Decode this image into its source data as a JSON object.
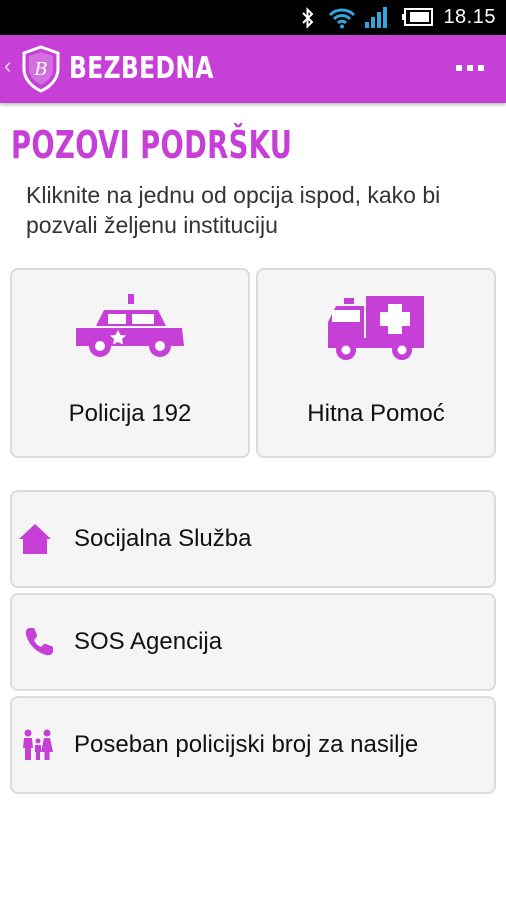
{
  "status_bar": {
    "time": "18.15",
    "icons": [
      "bluetooth-icon",
      "wifi-icon",
      "signal-icon",
      "battery-icon"
    ]
  },
  "app_bar": {
    "title": "BEZBEDNA",
    "logo_letter": "B",
    "back_icon": "back-chevron-icon",
    "menu_icon": "overflow-menu-icon"
  },
  "page": {
    "heading": "POZOVI PODRŠKU",
    "intro": "Kliknite na jednu od opcija ispod, kako bi pozvali željenu instituciju"
  },
  "tiles": [
    {
      "label": "Policija 192",
      "icon": "police-car-icon"
    },
    {
      "label": "Hitna Pomoć",
      "icon": "ambulance-icon"
    }
  ],
  "list": [
    {
      "label": "Socijalna Služba",
      "icon": "house-icon"
    },
    {
      "label": "SOS Agencija",
      "icon": "phone-icon"
    },
    {
      "label": "Poseban policijski broj za nasilje",
      "icon": "family-icon"
    }
  ],
  "colors": {
    "accent": "#c63fd6",
    "status_icon_blue": "#2fa6e0",
    "card_bg": "#f5f5f5",
    "card_border": "#dcdcdc"
  }
}
